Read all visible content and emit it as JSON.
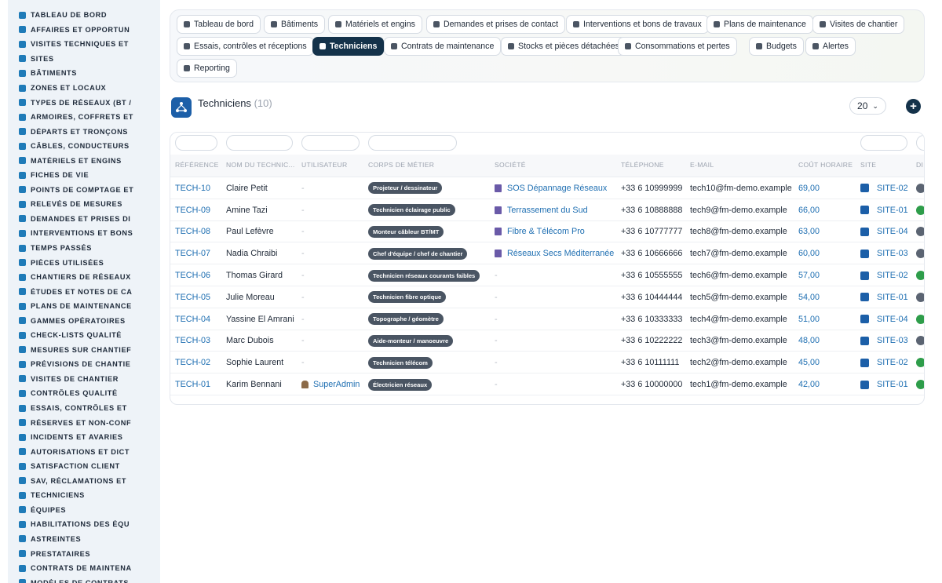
{
  "sidebar": {
    "items": [
      {
        "label": "TABLEAU DE BORD",
        "icon": "dashboard-icon"
      },
      {
        "label": "AFFAIRES ET OPPORTUN",
        "icon": "target-icon"
      },
      {
        "label": "VISITES TECHNIQUES ET",
        "icon": "clipboard-icon"
      },
      {
        "label": "SITES",
        "icon": "pin-icon"
      },
      {
        "label": "BÂTIMENTS",
        "icon": "building-icon"
      },
      {
        "label": "ZONES ET LOCAUX",
        "icon": "grid-icon"
      },
      {
        "label": "TYPES DE RÉSEAUX (BT /",
        "icon": "network-icon"
      },
      {
        "label": "ARMOIRES, COFFRETS ET",
        "icon": "cabinet-icon"
      },
      {
        "label": "DÉPARTS ET TRONÇONS",
        "icon": "plug-icon"
      },
      {
        "label": "CÂBLES, CONDUCTEURS",
        "icon": "cable-icon"
      },
      {
        "label": "MATÉRIELS ET ENGINS",
        "icon": "gears-icon"
      },
      {
        "label": "FICHES DE VIE",
        "icon": "history-icon"
      },
      {
        "label": "POINTS DE COMPTAGE ET",
        "icon": "meter-icon"
      },
      {
        "label": "RELEVÉS DE MESURES",
        "icon": "chart-icon"
      },
      {
        "label": "DEMANDES ET PRISES DI",
        "icon": "inbox-icon"
      },
      {
        "label": "INTERVENTIONS ET BONS",
        "icon": "wrench-icon"
      },
      {
        "label": "TEMPS PASSÉS",
        "icon": "clock-icon"
      },
      {
        "label": "PIÈCES UTILISÉES",
        "icon": "box-icon"
      },
      {
        "label": "CHANTIERS DE RÉSEAUX",
        "icon": "hammer-icon"
      },
      {
        "label": "ÉTUDES ET NOTES DE CA",
        "icon": "study-icon"
      },
      {
        "label": "PLANS DE MAINTENANCE",
        "icon": "calendar-icon"
      },
      {
        "label": "GAMMES OPÉRATOIRES",
        "icon": "list-icon"
      },
      {
        "label": "CHECK-LISTS QUALITÉ",
        "icon": "checklist-icon"
      },
      {
        "label": "MESURES SUR CHANTIEF",
        "icon": "ruler-icon"
      },
      {
        "label": "PRÉVISIONS DE CHANTIE",
        "icon": "trend-icon"
      },
      {
        "label": "VISITES DE CHANTIER",
        "icon": "walk-icon"
      },
      {
        "label": "CONTRÔLES QUALITÉ",
        "icon": "search-icon"
      },
      {
        "label": "ESSAIS, CONTRÔLES ET",
        "icon": "test-icon"
      },
      {
        "label": "RÉSERVES ET NON-CONF",
        "icon": "alert-icon"
      },
      {
        "label": "INCIDENTS ET AVARIES",
        "icon": "warning-icon"
      },
      {
        "label": "AUTORISATIONS ET DICT",
        "icon": "file-sign-icon"
      },
      {
        "label": "SATISFACTION CLIENT",
        "icon": "smile-icon"
      },
      {
        "label": "SAV, RÉCLAMATIONS ET",
        "icon": "comment-icon"
      },
      {
        "label": "TECHNICIENS",
        "icon": "hardhat-icon"
      },
      {
        "label": "ÉQUIPES",
        "icon": "users-icon"
      },
      {
        "label": "HABILITATIONS DES ÉQU",
        "icon": "badge-icon"
      },
      {
        "label": "ASTREINTES",
        "icon": "phone-icon"
      },
      {
        "label": "PRESTATAIRES",
        "icon": "handshake-icon"
      },
      {
        "label": "CONTRATS DE MAINTENA",
        "icon": "contract-icon"
      },
      {
        "label": "MODÈLES DE CONTRATS",
        "icon": "template-icon"
      }
    ]
  },
  "tabs": [
    {
      "label": "Tableau de bord",
      "icon": "dashboard-icon"
    },
    {
      "label": "Bâtiments",
      "icon": "building-icon"
    },
    {
      "label": "Matériels et engins",
      "icon": "gears-icon"
    },
    {
      "label": "Demandes et prises de contact",
      "icon": "question-icon"
    },
    {
      "label": "Interventions et bons de travaux",
      "icon": "clipboard-icon"
    },
    {
      "label": "Plans de maintenance",
      "icon": "calendar-icon"
    },
    {
      "label": "Visites de chantier",
      "icon": "walk-icon"
    },
    {
      "label": "Essais, contrôles et réceptions",
      "icon": "test-icon"
    },
    {
      "label": "Techniciens",
      "icon": "hardhat-icon",
      "active": true
    },
    {
      "label": "Contrats de maintenance",
      "icon": "contract-icon"
    },
    {
      "label": "Stocks et pièces détachées",
      "icon": "boxes-icon"
    },
    {
      "label": "Consommations et pertes",
      "icon": "bolt-icon"
    },
    {
      "label": "Budgets",
      "icon": "money-icon"
    },
    {
      "label": "Alertes",
      "icon": "bell-icon"
    },
    {
      "label": "Reporting",
      "icon": "pie-icon"
    }
  ],
  "page": {
    "title": "Techniciens",
    "count": "(10)",
    "per_page": "20",
    "add_label": "+"
  },
  "table": {
    "headers": [
      "RÉFÉRENCE",
      "NOM DU TECHNIC...",
      "UTILISATEUR",
      "CORPS DE MÉTIER",
      "SOCIÉTÉ",
      "TÉLÉPHONE",
      "E-MAIL",
      "COÛT HORAIRE",
      "SITE",
      "DI"
    ],
    "rows": [
      {
        "ref": "TECH-10",
        "name": "Claire Petit",
        "user": "-",
        "trade": "Projeteur / dessinateur",
        "company": "SOS Dépannage Réseaux",
        "phone": "+33 6 10999999",
        "email": "tech10@fm-demo.example",
        "rate": "69,00",
        "site": "SITE-02",
        "dot": "#5b6472"
      },
      {
        "ref": "TECH-09",
        "name": "Amine Tazi",
        "user": "-",
        "trade": "Technicien éclairage public",
        "company": "Terrassement du Sud",
        "phone": "+33 6 10888888",
        "email": "tech9@fm-demo.example",
        "rate": "66,00",
        "site": "SITE-01",
        "dot": "#2e9d4a"
      },
      {
        "ref": "TECH-08",
        "name": "Paul Lefèvre",
        "user": "-",
        "trade": "Monteur câbleur BT/MT",
        "company": "Fibre & Télécom Pro",
        "phone": "+33 6 10777777",
        "email": "tech8@fm-demo.example",
        "rate": "63,00",
        "site": "SITE-04",
        "dot": "#5b6472"
      },
      {
        "ref": "TECH-07",
        "name": "Nadia Chraibi",
        "user": "-",
        "trade": "Chef d'équipe / chef de chantier",
        "company": "Réseaux Secs Méditerranée",
        "phone": "+33 6 10666666",
        "email": "tech7@fm-demo.example",
        "rate": "60,00",
        "site": "SITE-03",
        "dot": "#5b6472"
      },
      {
        "ref": "TECH-06",
        "name": "Thomas Girard",
        "user": "-",
        "trade": "Technicien réseaux courants faibles",
        "company": "-",
        "phone": "+33 6 10555555",
        "email": "tech6@fm-demo.example",
        "rate": "57,00",
        "site": "SITE-02",
        "dot": "#2e9d4a"
      },
      {
        "ref": "TECH-05",
        "name": "Julie Moreau",
        "user": "-",
        "trade": "Technicien fibre optique",
        "company": "-",
        "phone": "+33 6 10444444",
        "email": "tech5@fm-demo.example",
        "rate": "54,00",
        "site": "SITE-01",
        "dot": "#5b6472"
      },
      {
        "ref": "TECH-04",
        "name": "Yassine El Amrani",
        "user": "-",
        "trade": "Topographe / géomètre",
        "company": "-",
        "phone": "+33 6 10333333",
        "email": "tech4@fm-demo.example",
        "rate": "51,00",
        "site": "SITE-04",
        "dot": "#2e9d4a"
      },
      {
        "ref": "TECH-03",
        "name": "Marc Dubois",
        "user": "-",
        "trade": "Aide-monteur / manoeuvre",
        "company": "-",
        "phone": "+33 6 10222222",
        "email": "tech3@fm-demo.example",
        "rate": "48,00",
        "site": "SITE-03",
        "dot": "#5b6472"
      },
      {
        "ref": "TECH-02",
        "name": "Sophie Laurent",
        "user": "-",
        "trade": "Technicien télécom",
        "company": "-",
        "phone": "+33 6 10111111",
        "email": "tech2@fm-demo.example",
        "rate": "45,00",
        "site": "SITE-02",
        "dot": "#2e9d4a"
      },
      {
        "ref": "TECH-01",
        "name": "Karim Bennani",
        "user": "SuperAdmin",
        "trade": "Électricien réseaux",
        "company": "-",
        "phone": "+33 6 10000000",
        "email": "tech1@fm-demo.example",
        "rate": "42,00",
        "site": "SITE-01",
        "dot": "#2e9d4a"
      }
    ]
  }
}
